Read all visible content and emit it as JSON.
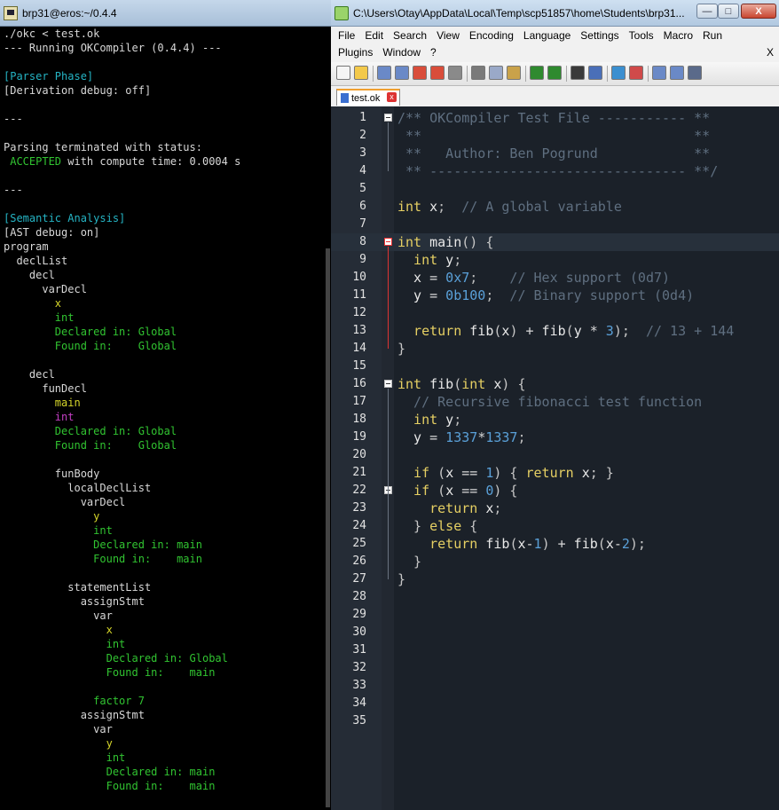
{
  "terminal": {
    "title": "brp31@eros:~/0.4.4",
    "lines": [
      {
        "segments": [
          {
            "text": "./okc < test.ok",
            "color": "white"
          }
        ]
      },
      {
        "segments": [
          {
            "text": "--- Running OKCompiler (0.4.4) ---",
            "color": "white"
          }
        ]
      },
      {
        "segments": [
          {
            "text": "",
            "color": "white"
          }
        ]
      },
      {
        "segments": [
          {
            "text": "[Parser Phase]",
            "color": "cyan"
          }
        ]
      },
      {
        "segments": [
          {
            "text": "[Derivation debug: off]",
            "color": "white"
          }
        ]
      },
      {
        "segments": [
          {
            "text": "",
            "color": "white"
          }
        ]
      },
      {
        "segments": [
          {
            "text": "---",
            "color": "white"
          }
        ]
      },
      {
        "segments": [
          {
            "text": "",
            "color": "white"
          }
        ]
      },
      {
        "segments": [
          {
            "text": "Parsing terminated with status:",
            "color": "white"
          }
        ]
      },
      {
        "segments": [
          {
            "text": " ACCEPTED",
            "color": "green"
          },
          {
            "text": " with compute time: 0.0004 s",
            "color": "white"
          }
        ]
      },
      {
        "segments": [
          {
            "text": "",
            "color": "white"
          }
        ]
      },
      {
        "segments": [
          {
            "text": "---",
            "color": "white"
          }
        ]
      },
      {
        "segments": [
          {
            "text": "",
            "color": "white"
          }
        ]
      },
      {
        "segments": [
          {
            "text": "[Semantic Analysis]",
            "color": "cyan"
          }
        ]
      },
      {
        "segments": [
          {
            "text": "[AST debug: on]",
            "color": "white"
          }
        ]
      },
      {
        "segments": [
          {
            "text": "program",
            "color": "white"
          }
        ]
      },
      {
        "segments": [
          {
            "text": "  declList",
            "color": "white"
          }
        ]
      },
      {
        "segments": [
          {
            "text": "    decl",
            "color": "white"
          }
        ]
      },
      {
        "segments": [
          {
            "text": "      varDecl",
            "color": "white"
          }
        ]
      },
      {
        "segments": [
          {
            "text": "        x",
            "color": "yellow"
          }
        ]
      },
      {
        "segments": [
          {
            "text": "        int",
            "color": "green"
          }
        ]
      },
      {
        "segments": [
          {
            "text": "        Declared in: Global",
            "color": "green"
          }
        ]
      },
      {
        "segments": [
          {
            "text": "        Found in:    Global",
            "color": "green"
          }
        ]
      },
      {
        "segments": [
          {
            "text": "",
            "color": "white"
          }
        ]
      },
      {
        "segments": [
          {
            "text": "    decl",
            "color": "white"
          }
        ]
      },
      {
        "segments": [
          {
            "text": "      funDecl",
            "color": "white"
          }
        ]
      },
      {
        "segments": [
          {
            "text": "        main",
            "color": "yellow"
          }
        ]
      },
      {
        "segments": [
          {
            "text": "        int",
            "color": "magenta"
          }
        ]
      },
      {
        "segments": [
          {
            "text": "        Declared in: Global",
            "color": "green"
          }
        ]
      },
      {
        "segments": [
          {
            "text": "        Found in:    Global",
            "color": "green"
          }
        ]
      },
      {
        "segments": [
          {
            "text": "",
            "color": "white"
          }
        ]
      },
      {
        "segments": [
          {
            "text": "        funBody",
            "color": "white"
          }
        ]
      },
      {
        "segments": [
          {
            "text": "          localDeclList",
            "color": "white"
          }
        ]
      },
      {
        "segments": [
          {
            "text": "            varDecl",
            "color": "white"
          }
        ]
      },
      {
        "segments": [
          {
            "text": "              y",
            "color": "yellow"
          }
        ]
      },
      {
        "segments": [
          {
            "text": "              int",
            "color": "green"
          }
        ]
      },
      {
        "segments": [
          {
            "text": "              Declared in: main",
            "color": "green"
          }
        ]
      },
      {
        "segments": [
          {
            "text": "              Found in:    main",
            "color": "green"
          }
        ]
      },
      {
        "segments": [
          {
            "text": "",
            "color": "white"
          }
        ]
      },
      {
        "segments": [
          {
            "text": "          statementList",
            "color": "white"
          }
        ]
      },
      {
        "segments": [
          {
            "text": "            assignStmt",
            "color": "white"
          }
        ]
      },
      {
        "segments": [
          {
            "text": "              var",
            "color": "white"
          }
        ]
      },
      {
        "segments": [
          {
            "text": "                x",
            "color": "yellow"
          }
        ]
      },
      {
        "segments": [
          {
            "text": "                int",
            "color": "green"
          }
        ]
      },
      {
        "segments": [
          {
            "text": "                Declared in: Global",
            "color": "green"
          }
        ]
      },
      {
        "segments": [
          {
            "text": "                Found in:    main",
            "color": "green"
          }
        ]
      },
      {
        "segments": [
          {
            "text": "",
            "color": "white"
          }
        ]
      },
      {
        "segments": [
          {
            "text": "              factor 7",
            "color": "green"
          }
        ]
      },
      {
        "segments": [
          {
            "text": "            assignStmt",
            "color": "white"
          }
        ]
      },
      {
        "segments": [
          {
            "text": "              var",
            "color": "white"
          }
        ]
      },
      {
        "segments": [
          {
            "text": "                y",
            "color": "yellow"
          }
        ]
      },
      {
        "segments": [
          {
            "text": "                int",
            "color": "green"
          }
        ]
      },
      {
        "segments": [
          {
            "text": "                Declared in: main",
            "color": "green"
          }
        ]
      },
      {
        "segments": [
          {
            "text": "                Found in:    main",
            "color": "green"
          }
        ]
      }
    ]
  },
  "notepad": {
    "title": "C:\\Users\\Otay\\AppData\\Local\\Temp\\scp51857\\home\\Students\\brp31...",
    "window_buttons": {
      "minimize": "—",
      "maximize": "□",
      "close": "X"
    },
    "menu_row1": [
      "File",
      "Edit",
      "Search",
      "View",
      "Encoding",
      "Language",
      "Settings",
      "Tools",
      "Macro",
      "Run"
    ],
    "menu_row2": [
      "Plugins",
      "Window",
      "?"
    ],
    "menu_close": "X",
    "tab": {
      "label": "test.ok",
      "close_glyph": "x"
    },
    "toolbar_icons": [
      "new-file-icon",
      "open-file-icon",
      "save-icon",
      "save-all-icon",
      "close-icon",
      "close-all-icon",
      "print-icon",
      "cut-icon",
      "copy-icon",
      "paste-icon",
      "undo-icon",
      "redo-icon",
      "find-icon",
      "replace-icon",
      "zoom-in-icon",
      "zoom-out-icon",
      "sync-vertical-icon",
      "sync-horizontal-icon",
      "word-wrap-icon"
    ],
    "current_line": 8,
    "code_lines": [
      [
        {
          "t": "/** OKCompiler Test File ----------- **",
          "c": "cm"
        }
      ],
      [
        {
          "t": " **                                  **",
          "c": "cm"
        }
      ],
      [
        {
          "t": " **   Author: Ben Pogrund            **",
          "c": "cm"
        }
      ],
      [
        {
          "t": " ** -------------------------------- **/",
          "c": "cm"
        }
      ],
      [],
      [
        {
          "t": "int",
          "c": "k"
        },
        {
          "t": " x",
          "c": "i"
        },
        {
          "t": ";",
          "c": "p"
        },
        {
          "t": "  // A global variable",
          "c": "cm"
        }
      ],
      [],
      [
        {
          "t": "int",
          "c": "k"
        },
        {
          "t": " main",
          "c": "i"
        },
        {
          "t": "() {",
          "c": "br"
        }
      ],
      [
        {
          "t": "  int",
          "c": "k"
        },
        {
          "t": " y",
          "c": "i"
        },
        {
          "t": ";",
          "c": "p"
        }
      ],
      [
        {
          "t": "  x ",
          "c": "i"
        },
        {
          "t": "=",
          "c": "op"
        },
        {
          "t": " 0x7",
          "c": "n"
        },
        {
          "t": ";",
          "c": "p"
        },
        {
          "t": "    // Hex support (0d7)",
          "c": "cm"
        }
      ],
      [
        {
          "t": "  y ",
          "c": "i"
        },
        {
          "t": "=",
          "c": "op"
        },
        {
          "t": " 0b100",
          "c": "n"
        },
        {
          "t": ";",
          "c": "p"
        },
        {
          "t": "  // Binary support (0d4)",
          "c": "cm"
        }
      ],
      [],
      [
        {
          "t": "  return",
          "c": "k"
        },
        {
          "t": " fib",
          "c": "i"
        },
        {
          "t": "(",
          "c": "br"
        },
        {
          "t": "x",
          "c": "i"
        },
        {
          "t": ") ",
          "c": "br"
        },
        {
          "t": "+",
          "c": "op"
        },
        {
          "t": " fib",
          "c": "i"
        },
        {
          "t": "(",
          "c": "br"
        },
        {
          "t": "y ",
          "c": "i"
        },
        {
          "t": "*",
          "c": "op"
        },
        {
          "t": " 3",
          "c": "n"
        },
        {
          "t": ");",
          "c": "br"
        },
        {
          "t": "  // 13 + 144",
          "c": "cm"
        }
      ],
      [
        {
          "t": "}",
          "c": "br"
        }
      ],
      [],
      [
        {
          "t": "int",
          "c": "k"
        },
        {
          "t": " fib",
          "c": "i"
        },
        {
          "t": "(",
          "c": "br"
        },
        {
          "t": "int",
          "c": "k"
        },
        {
          "t": " x",
          "c": "i"
        },
        {
          "t": ") {",
          "c": "br"
        }
      ],
      [
        {
          "t": "  // Recursive fibonacci test function",
          "c": "cm"
        }
      ],
      [
        {
          "t": "  int",
          "c": "k"
        },
        {
          "t": " y",
          "c": "i"
        },
        {
          "t": ";",
          "c": "p"
        }
      ],
      [
        {
          "t": "  y ",
          "c": "i"
        },
        {
          "t": "=",
          "c": "op"
        },
        {
          "t": " 1337",
          "c": "n"
        },
        {
          "t": "*",
          "c": "op"
        },
        {
          "t": "1337",
          "c": "n"
        },
        {
          "t": ";",
          "c": "p"
        }
      ],
      [],
      [
        {
          "t": "  if",
          "c": "k"
        },
        {
          "t": " (",
          "c": "br"
        },
        {
          "t": "x ",
          "c": "i"
        },
        {
          "t": "==",
          "c": "op"
        },
        {
          "t": " 1",
          "c": "n"
        },
        {
          "t": ") { ",
          "c": "br"
        },
        {
          "t": "return",
          "c": "k"
        },
        {
          "t": " x",
          "c": "i"
        },
        {
          "t": "; }",
          "c": "br"
        }
      ],
      [
        {
          "t": "  if",
          "c": "k"
        },
        {
          "t": " (",
          "c": "br"
        },
        {
          "t": "x ",
          "c": "i"
        },
        {
          "t": "==",
          "c": "op"
        },
        {
          "t": " 0",
          "c": "n"
        },
        {
          "t": ") {",
          "c": "br"
        }
      ],
      [
        {
          "t": "    return",
          "c": "k"
        },
        {
          "t": " x",
          "c": "i"
        },
        {
          "t": ";",
          "c": "p"
        }
      ],
      [
        {
          "t": "  } ",
          "c": "br"
        },
        {
          "t": "else",
          "c": "k"
        },
        {
          "t": " {",
          "c": "br"
        }
      ],
      [
        {
          "t": "    return",
          "c": "k"
        },
        {
          "t": " fib",
          "c": "i"
        },
        {
          "t": "(",
          "c": "br"
        },
        {
          "t": "x",
          "c": "i"
        },
        {
          "t": "-",
          "c": "op"
        },
        {
          "t": "1",
          "c": "n"
        },
        {
          "t": ") ",
          "c": "br"
        },
        {
          "t": "+",
          "c": "op"
        },
        {
          "t": " fib",
          "c": "i"
        },
        {
          "t": "(",
          "c": "br"
        },
        {
          "t": "x",
          "c": "i"
        },
        {
          "t": "-",
          "c": "op"
        },
        {
          "t": "2",
          "c": "n"
        },
        {
          "t": ");",
          "c": "br"
        }
      ],
      [
        {
          "t": "  }",
          "c": "br"
        }
      ],
      [
        {
          "t": "}",
          "c": "br"
        }
      ],
      [],
      [],
      [],
      [],
      [],
      [],
      [],
      []
    ],
    "fold_markers": [
      {
        "line": 1,
        "color": "gray"
      },
      {
        "line": 8,
        "color": "red"
      },
      {
        "line": 16,
        "color": "gray"
      },
      {
        "line": 22,
        "color": "gray"
      }
    ]
  },
  "colors": {
    "terminal_bg": "#000000",
    "terminal_cyan": "#25b4c4",
    "terminal_green": "#31c431",
    "terminal_yellow": "#d6d62a",
    "terminal_magenta": "#c43ec4",
    "editor_bg": "#1b2129",
    "keyword": "#e5cf63",
    "comment": "#5f6f80",
    "number": "#5aa0d8",
    "tab_accent": "#f0a030"
  }
}
